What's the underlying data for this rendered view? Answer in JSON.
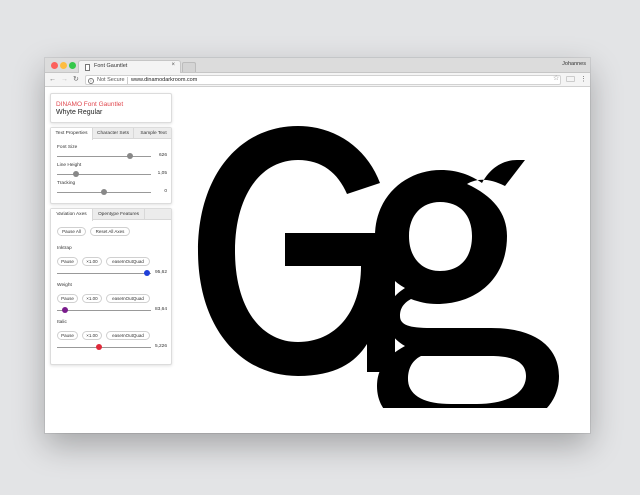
{
  "browser": {
    "tab_title": "Font Gauntlet",
    "tab_close": "×",
    "profile": "Johannes",
    "security_label": "Not Secure",
    "url": "www.dinamodarkroom.com",
    "icons": [
      "back-icon",
      "forward-icon",
      "reload-icon",
      "info-icon",
      "star-icon",
      "extension-icon",
      "menu-icon"
    ]
  },
  "header": {
    "brand": "DINAMO Font Gauntlet",
    "font_name": "Whyte Regular",
    "brand_color": "#e0484f"
  },
  "text_properties": {
    "tabs": [
      "Text Properties",
      "Character Sets",
      "Sample Text"
    ],
    "font_size": {
      "label": "Font Size",
      "value": "626",
      "fraction": 0.78
    },
    "line_height": {
      "label": "Line Height",
      "value": "1,05",
      "fraction": 0.2
    },
    "tracking": {
      "label": "Tracking",
      "value": "0",
      "fraction": 0.5
    }
  },
  "axes": {
    "tabs": [
      "Variation Axes",
      "Opentype Features"
    ],
    "pause_all": "Pause All",
    "reset_all": "Reset All Axes",
    "items": [
      {
        "name": "Inktrap",
        "pause": "Pause",
        "speed": "×1.00",
        "easing": "easeInOutQuad",
        "value": "95,62",
        "fraction": 0.96,
        "color": "#1f3fd9"
      },
      {
        "name": "Weight",
        "pause": "Pause",
        "speed": "×1.00",
        "easing": "easeInOutQuad",
        "value": "83,64",
        "fraction": 0.08,
        "color": "#7a1c8c"
      },
      {
        "name": "Italic",
        "pause": "Pause",
        "speed": "×1.00",
        "easing": "easeInOutQuad",
        "value": "5,226",
        "fraction": 0.45,
        "color": "#e02a3a"
      }
    ]
  },
  "specimen": {
    "text": "Gg"
  }
}
